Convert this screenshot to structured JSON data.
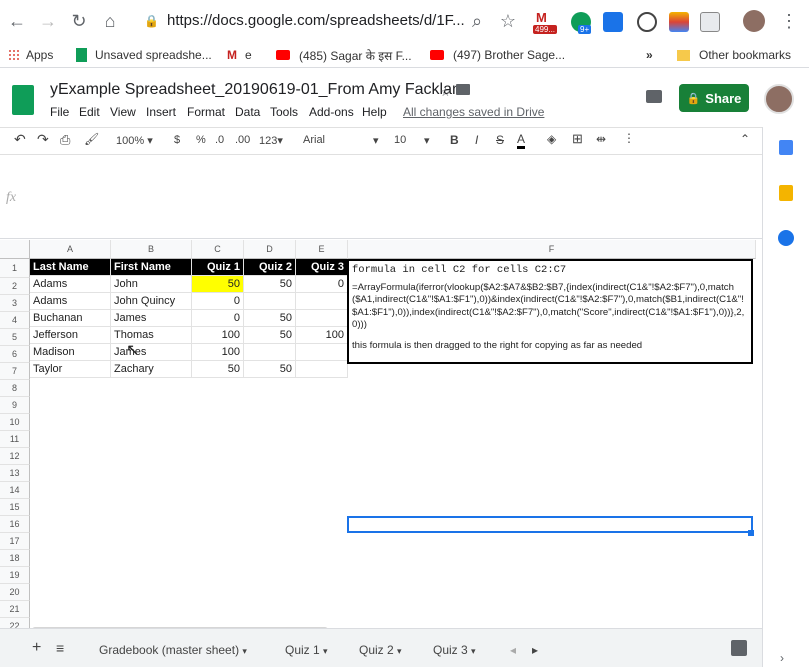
{
  "browser": {
    "url": "https://docs.google.com/spreadsheets/d/1F...",
    "badge_gmail": "499...",
    "badge_ext": "9+",
    "bookmarks": [
      {
        "label": "Apps"
      },
      {
        "label": "Unsaved spreadshe..."
      },
      {
        "label": "e"
      },
      {
        "label": "(485) Sagar के इस F..."
      },
      {
        "label": "(497) Brother Sage..."
      }
    ],
    "more_bookmarks": "»",
    "other_bookmarks": "Other bookmarks"
  },
  "doc": {
    "title": "yExample Spreadsheet_20190619-01_From Amy Facklam",
    "menus": [
      "File",
      "Edit",
      "View",
      "Insert",
      "Format",
      "Data",
      "Tools",
      "Add-ons",
      "Help"
    ],
    "saved_status": "All changes saved in Drive",
    "share_label": "Share"
  },
  "toolbar": {
    "zoom": "100%",
    "currency": "$",
    "percent": "%",
    "dec_less": ".0",
    "dec_more": ".00",
    "format_more": "123",
    "font": "Arial",
    "font_size": "10",
    "bold": "B",
    "italic": "I",
    "strike": "S",
    "text_color": "A"
  },
  "formula_bar": {
    "fx": "fx"
  },
  "grid": {
    "columns": [
      "A",
      "B",
      "C",
      "D",
      "E",
      "F"
    ],
    "rows": [
      "1",
      "2",
      "3",
      "4",
      "5",
      "6",
      "7",
      "8",
      "9",
      "10",
      "11",
      "12",
      "13",
      "14",
      "15",
      "16",
      "17",
      "18",
      "19",
      "20",
      "21",
      "22"
    ],
    "header_row": [
      "Last Name",
      "First Name",
      "Quiz 1",
      "Quiz 2",
      "Quiz 3"
    ],
    "data": [
      [
        "Adams",
        "John",
        "50",
        "50",
        "0"
      ],
      [
        "Adams",
        "John Quincy",
        "0",
        "",
        ""
      ],
      [
        "Buchanan",
        "James",
        "0",
        "50",
        ""
      ],
      [
        "Jefferson",
        "Thomas",
        "100",
        "50",
        "100"
      ],
      [
        "Madison",
        "James",
        "100",
        "",
        ""
      ],
      [
        "Taylor",
        "Zachary",
        "50",
        "50",
        ""
      ]
    ],
    "highlight_color": "#ffff00",
    "f_title": "formula in cell C2 for cells C2:C7",
    "f_formula": "=ArrayFormula(iferror(vlookup($A2:$A7&$B2:$B7,{index(indirect(C1&\"!$A2:$F7\"),0,match($A1,indirect(C1&\"!$A1:$F1\"),0))&index(indirect(C1&\"!$A2:$F7\"),0,match($B1,indirect(C1&\"!$A1:$F1\"),0)),index(indirect(C1&\"!$A2:$F7\"),0,match(\"Score\",indirect(C1&\"!$A1:$F1\"),0))},2,0)))",
    "f_note": "this formula is then dragged to the right for copying as far as needed"
  },
  "tabs": {
    "add": "+",
    "list": "≡",
    "items": [
      "Gradebook (master sheet)",
      "Quiz 1",
      "Quiz 2",
      "Quiz 3"
    ]
  },
  "colors": {
    "share": "#188038",
    "selection": "#1a73e8"
  }
}
